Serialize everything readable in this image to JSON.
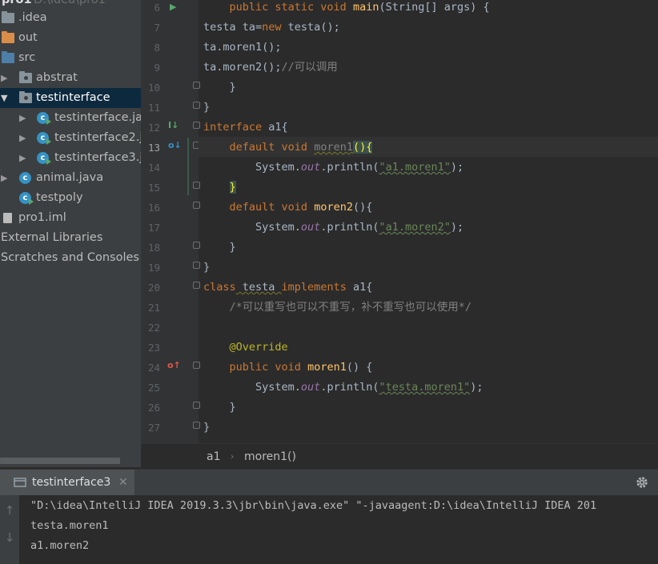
{
  "project": {
    "header_partial": "pro1",
    "header_path_partial": "D:\\idea\\pro1",
    "items": [
      {
        "label": ".idea",
        "icon": "folder-icon"
      },
      {
        "label": "out",
        "icon": "folder-orange-icon"
      },
      {
        "label": "src",
        "icon": "source-folder-icon"
      },
      {
        "label": "abstrat",
        "icon": "package-icon"
      },
      {
        "label": "testinterface",
        "icon": "package-icon"
      },
      {
        "label": "testinterface.ja",
        "icon": "class-icon"
      },
      {
        "label": "testinterface2.j",
        "icon": "class-icon"
      },
      {
        "label": "testinterface3.j",
        "icon": "class-icon"
      },
      {
        "label": "animal.java",
        "icon": "class-icon"
      },
      {
        "label": "testpoly",
        "icon": "class-icon"
      },
      {
        "label": "pro1.iml",
        "icon": "file-icon"
      },
      {
        "label": "External Libraries",
        "icon": "library-icon"
      },
      {
        "label": "Scratches and Consoles",
        "icon": "scratch-icon"
      }
    ]
  },
  "editor": {
    "line_numbers": [
      "6",
      "7",
      "8",
      "9",
      "10",
      "11",
      "12",
      "13",
      "14",
      "15",
      "16",
      "17",
      "18",
      "19",
      "20",
      "21",
      "22",
      "23",
      "24",
      "25",
      "26",
      "27"
    ],
    "code": {
      "l6_a": "    ",
      "l6_kw": "public static void ",
      "l6_fn": "main",
      "l6_rest": "(String[] args) {",
      "l7_a": "testa ta=",
      "l7_kw": "new",
      "l7_rest": " testa();",
      "l8": "ta.moren1();",
      "l9_a": "ta.moren2();",
      "l9_cm": "//可以调用",
      "l10": "    }",
      "l11": "}",
      "l12_kw": "interface",
      "l12_rest": " a1{",
      "l13_a": "    ",
      "l13_kw": "default void ",
      "l13_fn": "moren1",
      "l13_b1": "()",
      "l13_b2": "{",
      "l14_a": "        System.",
      "l14_it": "out",
      "l14_b": ".println(",
      "l14_str": "\"a1.moren1\"",
      "l14_c": ");",
      "l15_a": "    ",
      "l15_b": "}",
      "l16_a": "    ",
      "l16_kw": "default void ",
      "l16_fn": "moren2",
      "l16_rest": "(){",
      "l17_a": "        System.",
      "l17_it": "out",
      "l17_b": ".println(",
      "l17_str": "\"a1.moren2\"",
      "l17_c": ");",
      "l18": "    }",
      "l19": "}",
      "l20_kw": "class",
      "l20_b": " testa ",
      "l20_kw2": "implements",
      "l20_c": " a1{",
      "l21_a": "    ",
      "l21_cm": "/*可以重写也可以不重写，补不重写也可以使用*/",
      "l23_a": "    ",
      "l23_an": "@Override",
      "l24_a": "    ",
      "l24_kw": "public void ",
      "l24_fn": "moren1",
      "l24_rest": "() {",
      "l25_a": "        System.",
      "l25_it": "out",
      "l25_b": ".println(",
      "l25_str": "\"testa.moren1\"",
      "l25_c": ");",
      "l26": "    }",
      "l27": "}"
    }
  },
  "breadcrumbs": [
    "a1",
    "moren1()"
  ],
  "run": {
    "tab_label": "testinterface3",
    "output": [
      "\"D:\\idea\\IntelliJ IDEA 2019.3.3\\jbr\\bin\\java.exe\" \"-javaagent:D:\\idea\\IntelliJ IDEA 201",
      "testa.moren1",
      "a1.moren2"
    ]
  },
  "colors": {
    "keyword": "#cc7832",
    "method": "#ffc66d",
    "string": "#6a8759",
    "comment": "#808080",
    "field": "#9876aa",
    "annotation": "#bbb529",
    "selection": "#0d293e"
  }
}
